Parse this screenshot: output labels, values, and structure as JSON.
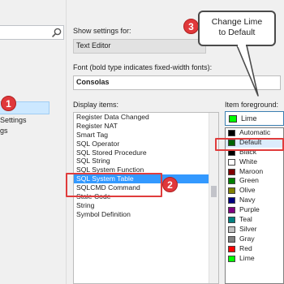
{
  "left_panel": {
    "tree_items": [
      "Settings",
      "gs"
    ]
  },
  "show_settings": {
    "label": "Show settings for:",
    "value": "Text Editor"
  },
  "font": {
    "label": "Font (bold type indicates fixed-width fonts):",
    "value": "Consolas"
  },
  "display_items": {
    "label": "Display items:",
    "items": [
      "Register Data Changed",
      "Register NAT",
      "Smart Tag",
      "SQL Operator",
      "SQL Stored Procedure",
      "SQL String",
      "SQL System Function",
      "SQL System Table",
      "SQLCMD Command",
      "Stale Code",
      "String",
      "Symbol Definition"
    ],
    "selected": "SQL System Table"
  },
  "item_foreground": {
    "label": "Item foreground:",
    "selected_value": "Lime",
    "selected_color": "#00ff00",
    "options": [
      {
        "label": "Automatic",
        "color": "#000000"
      },
      {
        "label": "Default",
        "color": "#006400"
      },
      {
        "label": "Black",
        "color": "#000000"
      },
      {
        "label": "White",
        "color": "#ffffff"
      },
      {
        "label": "Maroon",
        "color": "#800000"
      },
      {
        "label": "Green",
        "color": "#008000"
      },
      {
        "label": "Olive",
        "color": "#808000"
      },
      {
        "label": "Navy",
        "color": "#000080"
      },
      {
        "label": "Purple",
        "color": "#800080"
      },
      {
        "label": "Teal",
        "color": "#008080"
      },
      {
        "label": "Silver",
        "color": "#c0c0c0"
      },
      {
        "label": "Gray",
        "color": "#808080"
      },
      {
        "label": "Red",
        "color": "#ff0000"
      },
      {
        "label": "Lime",
        "color": "#00ff00"
      }
    ]
  },
  "annotations": {
    "step1": "1",
    "step2": "2",
    "step3": "3",
    "callout_line1": "Change Lime",
    "callout_line2": "to Default",
    "color": "#e03c3c"
  }
}
